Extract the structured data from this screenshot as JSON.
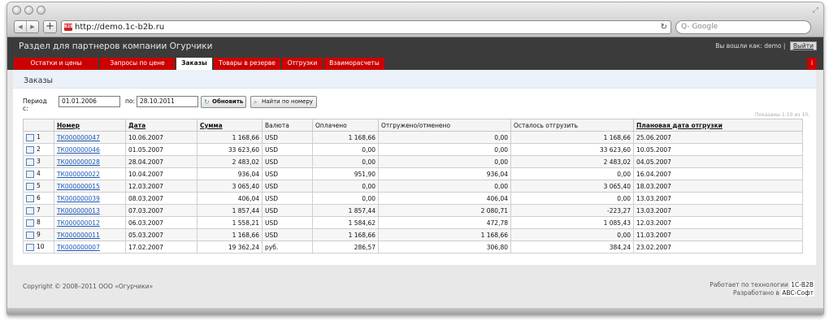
{
  "browser": {
    "url": "http://demo.1c-b2b.ru",
    "favicon_text": "B2B",
    "search_placeholder": "Q- Google",
    "icons": [
      "back-icon",
      "forward-icon",
      "add-icon",
      "reload-icon",
      "resize-icon"
    ]
  },
  "header": {
    "title": "Раздел для партнеров компании Огурчики",
    "login_label": "Вы вошли как: demo",
    "separator": "|",
    "logout_label": "Выйти"
  },
  "tabs": [
    {
      "label": "Остатки и цены"
    },
    {
      "label": "Запросы по цене"
    },
    {
      "label": "Заказы"
    },
    {
      "label": "Товары в резерве"
    },
    {
      "label": "Отгрузки"
    },
    {
      "label": "Взаиморасчеты"
    }
  ],
  "tab_extra": "i",
  "colors": {
    "tab_red": "#cc0000",
    "header_dark": "#3b3b3b",
    "link_blue": "#1a57b8"
  },
  "page": {
    "title": "Заказы",
    "period_from_label": "Период с:",
    "period_from_value": "01.01.2006",
    "period_to_label": "по:",
    "period_to_value": "28.10.2011",
    "refresh_button": "Обновить",
    "find_button": "Найти по номеру",
    "shown_text": "Показаны 1-10 из 10."
  },
  "table": {
    "columns": [
      "",
      "Номер",
      "Дата",
      "Сумма",
      "Валюта",
      "Оплачено",
      "Отгружено/отменено",
      "Осталось отгрузить",
      "Плановая дата отгрузки"
    ],
    "rows": [
      [
        "1",
        "ТК000000047",
        "10.06.2007",
        "1 168,66",
        "USD",
        "1 168,66",
        "0,00",
        "1 168,66",
        "25.06.2007"
      ],
      [
        "2",
        "ТК000000046",
        "01.05.2007",
        "33 623,60",
        "USD",
        "0,00",
        "0,00",
        "33 623,60",
        "10.05.2007"
      ],
      [
        "3",
        "ТК000000028",
        "28.04.2007",
        "2 483,02",
        "USD",
        "0,00",
        "0,00",
        "2 483,02",
        "04.05.2007"
      ],
      [
        "4",
        "ТК000000022",
        "10.04.2007",
        "936,04",
        "USD",
        "951,90",
        "936,04",
        "0,00",
        "16.04.2007"
      ],
      [
        "5",
        "ТК000000015",
        "12.03.2007",
        "3 065,40",
        "USD",
        "0,00",
        "0,00",
        "3 065,40",
        "18.03.2007"
      ],
      [
        "6",
        "ТК000000039",
        "08.03.2007",
        "406,04",
        "USD",
        "0,00",
        "406,04",
        "0,00",
        "13.03.2007"
      ],
      [
        "7",
        "ТК000000013",
        "07.03.2007",
        "1 857,44",
        "USD",
        "1 857,44",
        "2 080,71",
        "-223,27",
        "13.03.2007"
      ],
      [
        "8",
        "ТК000000012",
        "06.03.2007",
        "1 558,21",
        "USD",
        "1 584,62",
        "472,78",
        "1 085,43",
        "12.03.2007"
      ],
      [
        "9",
        "ТК000000011",
        "05.03.2007",
        "1 168,66",
        "USD",
        "1 168,66",
        "1 168,66",
        "0,00",
        "11.03.2007"
      ],
      [
        "10",
        "ТК000000007",
        "17.02.2007",
        "19 362,24",
        "руб.",
        "286,57",
        "306,80",
        "384,24",
        "23.02.2007"
      ]
    ]
  },
  "footer": {
    "copyright": "Copyright © 2008–2011 ООО «Огурчики»",
    "powered_label": "Работает по технологии",
    "powered_badge": "1С-B2B",
    "developed_label": "Разработано в",
    "developed_badge": "ABC-Софт"
  }
}
